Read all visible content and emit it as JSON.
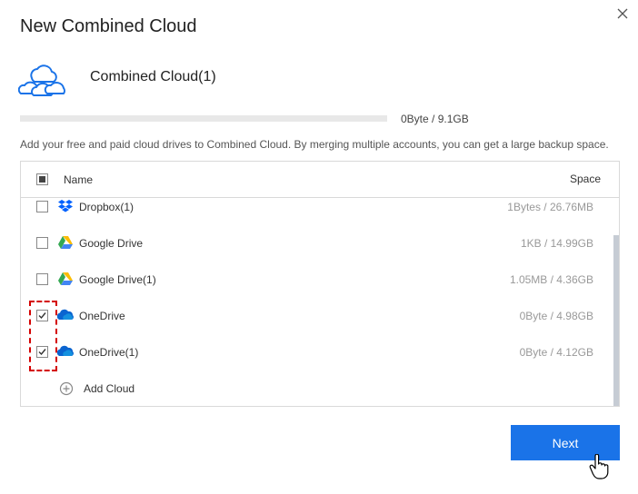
{
  "dialog": {
    "title": "New Combined Cloud",
    "close_icon": "close-icon"
  },
  "cloud": {
    "icon": "combined-cloud-icon",
    "name": "Combined Cloud(1)",
    "usage_text": "0Byte / 9.1GB",
    "usage_fraction": 0
  },
  "description": "Add your free and paid cloud drives to Combined Cloud. By merging multiple accounts, you can get a large backup space.",
  "table": {
    "header": {
      "select_all_state": "partial",
      "name": "Name",
      "space": "Space"
    },
    "rows": [
      {
        "name": "Dropbox(1)",
        "space": "1Bytes / 26.76MB",
        "icon": "dropbox-icon",
        "checked": false
      },
      {
        "name": "Google Drive",
        "space": "1KB / 14.99GB",
        "icon": "google-drive-icon",
        "checked": false
      },
      {
        "name": "Google Drive(1)",
        "space": "1.05MB / 4.36GB",
        "icon": "google-drive-icon",
        "checked": false
      },
      {
        "name": "OneDrive",
        "space": "0Byte / 4.98GB",
        "icon": "onedrive-icon",
        "checked": true
      },
      {
        "name": "OneDrive(1)",
        "space": "0Byte / 4.12GB",
        "icon": "onedrive-icon",
        "checked": true
      }
    ],
    "add_cloud_label": "Add Cloud"
  },
  "buttons": {
    "next": "Next"
  },
  "colors": {
    "accent": "#1a73e8",
    "highlight": "#d40000",
    "onedrive": "#0a64d0",
    "dropbox": "#0061fe"
  }
}
